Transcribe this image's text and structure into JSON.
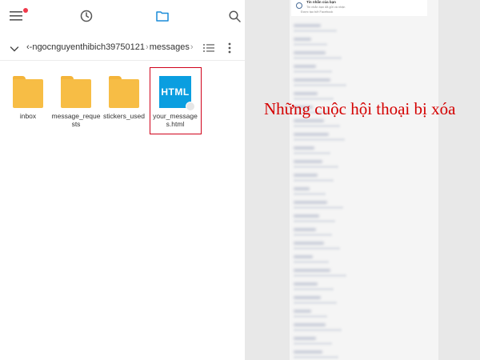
{
  "topbar": {
    "icons": [
      "menu-icon",
      "clock-icon",
      "folder-icon",
      "search-icon"
    ],
    "notification_color": "#f0394b"
  },
  "pathbar": {
    "segments": [
      "‹-ngocnguyenthibich39750121",
      "messages"
    ],
    "separator": "›"
  },
  "files": [
    {
      "name": "inbox",
      "type": "folder"
    },
    {
      "name": "message_requests",
      "type": "folder"
    },
    {
      "name": "stickers_used",
      "type": "folder"
    },
    {
      "name": "your_messages.html",
      "type": "html",
      "badge": "HTML",
      "selected": true
    }
  ],
  "messages_panel": {
    "header_title": "Tin nhắn của bạn",
    "header_subtitle": "Tin nhắn bạn đã gửi và nhận",
    "header_note": "Được tạo bởi Facebook"
  },
  "annotation": {
    "text": "Những cuộc hội thoại bị xóa",
    "color": "#d40000"
  },
  "colors": {
    "folder": "#f7bd45",
    "html_file": "#0a9ee0",
    "highlight_border": "#d0021b"
  }
}
